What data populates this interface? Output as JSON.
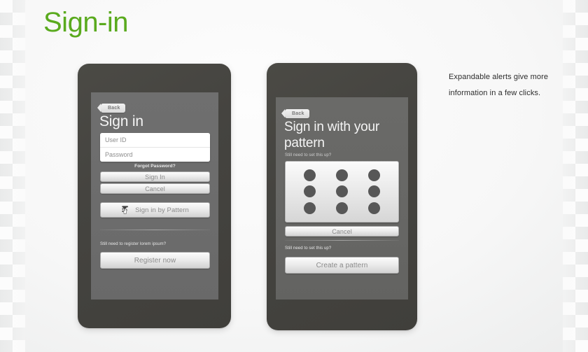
{
  "page": {
    "title": "Sign-in",
    "title_color": "#5aaa1e",
    "background_color": "#f3f3f3"
  },
  "annotation": {
    "text": "Expandable alerts give more information in a few clicks."
  },
  "phone_one": {
    "name": "sign-in-screen",
    "back_button": "Back",
    "heading": "Sign in",
    "fields": [
      {
        "name": "user-id-field",
        "placeholder": "User ID",
        "value": ""
      },
      {
        "name": "password-field",
        "placeholder": "Password",
        "value": ""
      }
    ],
    "forgot_password": "Forgot Password?",
    "primary_buttons": [
      {
        "name": "sign-in-button",
        "label": "Sign In"
      },
      {
        "name": "cancel-button",
        "label": "Cancel"
      }
    ],
    "pattern_button": {
      "label": "Sign in by Pattern",
      "icon": "hand-pattern-icon"
    },
    "register_hint": "Still need to register lorem ipsum?",
    "register_button": "Register now"
  },
  "phone_two": {
    "name": "pattern-sign-in-screen",
    "back_button": "Back",
    "heading": "Sign in with your pattern",
    "subtitle": "Still need to set this up?",
    "pattern_grid": {
      "rows": 3,
      "columns": 3,
      "dot_color": "#575757",
      "dot_count": 9
    },
    "cancel_button": "Cancel",
    "create_hint": "Still need to set this up?",
    "create_button": "Create a pattern"
  },
  "theme": {
    "phone_body": "#45443f",
    "screen_bg": "#6e6e6e",
    "button_text": "#8a8a8a",
    "heading_text": "#f4f4f4"
  }
}
